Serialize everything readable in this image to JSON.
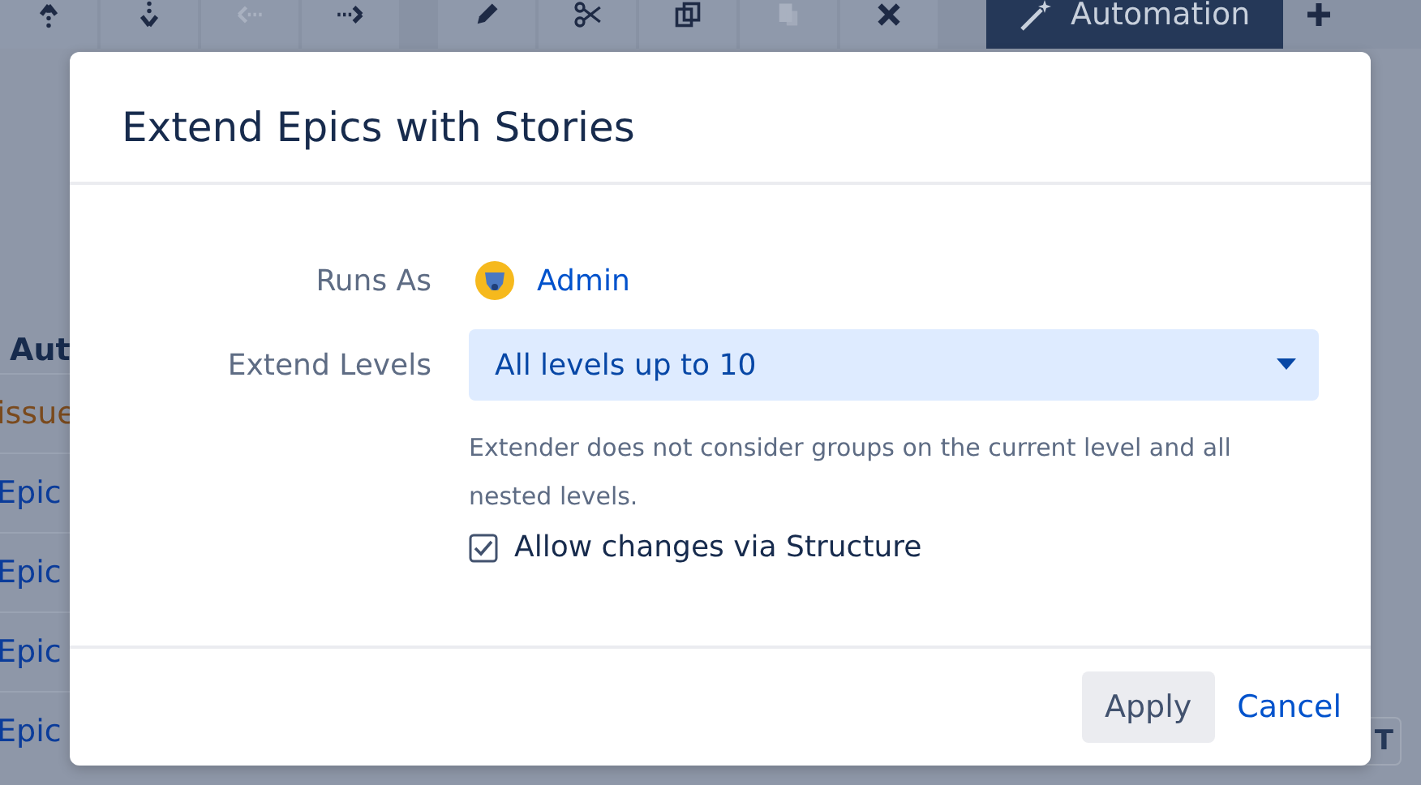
{
  "toolbar": {
    "icons": [
      {
        "kind": "up",
        "disabled": false
      },
      {
        "kind": "down",
        "disabled": false
      },
      {
        "kind": "left",
        "disabled": true
      },
      {
        "kind": "right",
        "disabled": false
      },
      {
        "kind": "pencil",
        "disabled": false
      },
      {
        "kind": "scissors",
        "disabled": false
      },
      {
        "kind": "copy",
        "disabled": false
      },
      {
        "kind": "paste",
        "disabled": true
      },
      {
        "kind": "delete",
        "disabled": false
      }
    ],
    "automation_button": "Automation"
  },
  "background_table": {
    "header": "Aut",
    "rows": [
      {
        "text": "issue",
        "kind": "issue"
      },
      {
        "text": "Epic",
        "kind": "epic"
      },
      {
        "text": "Epic",
        "kind": "epic"
      },
      {
        "text": "Epic",
        "kind": "epic"
      },
      {
        "text": "Epic",
        "kind": "epic"
      }
    ],
    "corner_button": "T"
  },
  "dialog": {
    "title": "Extend Epics with Stories",
    "runs_as": {
      "label": "Runs As",
      "value": "Admin"
    },
    "extend_levels": {
      "label": "Extend Levels",
      "value": "All levels up to 10",
      "hint": "Extender does not consider groups on the current level and all nested levels."
    },
    "allow_changes": {
      "label": "Allow changes via Structure",
      "checked": true
    },
    "buttons": {
      "apply": "Apply",
      "cancel": "Cancel"
    }
  }
}
